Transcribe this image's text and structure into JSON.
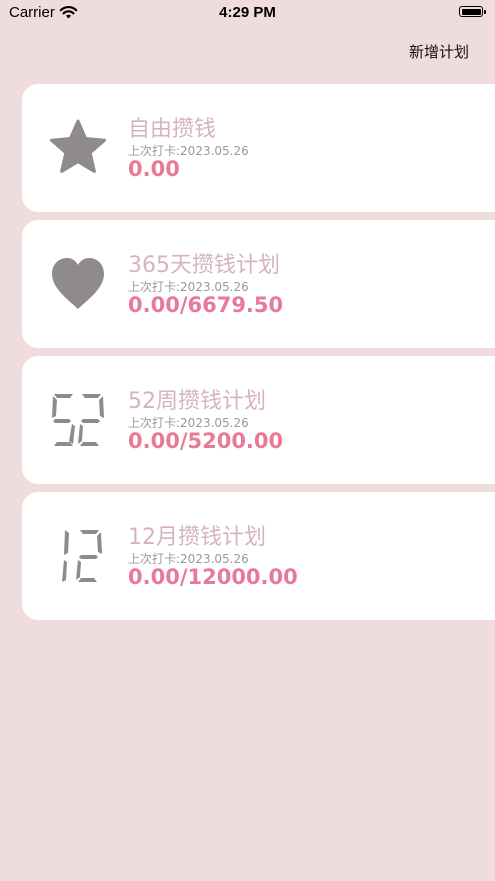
{
  "status_bar": {
    "carrier": "Carrier",
    "time": "4:29 PM"
  },
  "nav": {
    "add_plan_label": "新增计划"
  },
  "colors": {
    "background": "#efdcdd",
    "card": "#ffffff",
    "title": "#d6b4bd",
    "amount": "#e87a97",
    "icon": "#8e8a8e"
  },
  "plans": [
    {
      "icon": "star-icon",
      "title": "自由攒钱",
      "checkin": "上次打卡:2023.05.26",
      "amount": "0.00"
    },
    {
      "icon": "heart-icon",
      "title": "365天攒钱计划",
      "checkin": "上次打卡:2023.05.26",
      "amount": "0.00/6679.50"
    },
    {
      "icon": "digits-52-icon",
      "title": "52周攒钱计划",
      "checkin": "上次打卡:2023.05.26",
      "amount": "0.00/5200.00"
    },
    {
      "icon": "digits-12-icon",
      "title": "12月攒钱计划",
      "checkin": "上次打卡:2023.05.26",
      "amount": "0.00/12000.00"
    }
  ]
}
